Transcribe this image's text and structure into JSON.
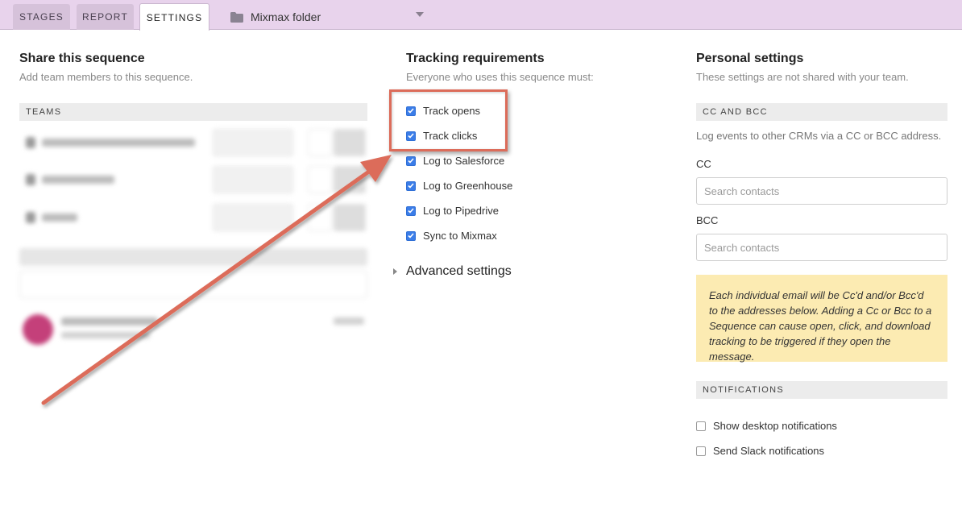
{
  "tabs": [
    {
      "label": "STAGES"
    },
    {
      "label": "REPORT"
    },
    {
      "label": "SETTINGS",
      "active": true
    }
  ],
  "folder": {
    "label": "Mixmax folder",
    "icon": "folder-icon"
  },
  "share": {
    "title": "Share this sequence",
    "subtitle": "Add team members to this sequence.",
    "teams_header": "TEAMS"
  },
  "tracking": {
    "title": "Tracking requirements",
    "subtitle": "Everyone who uses this sequence must:",
    "items": [
      {
        "label": "Track opens",
        "checked": true
      },
      {
        "label": "Track clicks",
        "checked": true
      },
      {
        "label": "Log to Salesforce",
        "checked": true
      },
      {
        "label": "Log to Greenhouse",
        "checked": true
      },
      {
        "label": "Log to Pipedrive",
        "checked": true
      },
      {
        "label": "Sync to Mixmax",
        "checked": true
      }
    ],
    "advanced_label": "Advanced settings"
  },
  "personal": {
    "title": "Personal settings",
    "subtitle": "These settings are not shared with your team.",
    "cc_bcc_header": "CC AND BCC",
    "cc_bcc_desc": "Log events to other CRMs via a CC or BCC address.",
    "cc_label": "CC",
    "cc_placeholder": "Search contacts",
    "bcc_label": "BCC",
    "bcc_placeholder": "Search contacts",
    "note": "Each individual email will be Cc'd and/or Bcc'd to the addresses below. Adding a Cc or Bcc to a Sequence can cause open, click, and download tracking to be triggered if they open the message.",
    "notifications_header": "NOTIFICATIONS",
    "notifications": [
      {
        "label": "Show desktop notifications",
        "checked": false
      },
      {
        "label": "Send Slack notifications",
        "checked": false
      }
    ]
  },
  "colors": {
    "topbar": "#e8d3ec",
    "checkbox": "#3b7de8",
    "annotation": "#dc6c5a",
    "note_bg": "#fcebb2"
  }
}
